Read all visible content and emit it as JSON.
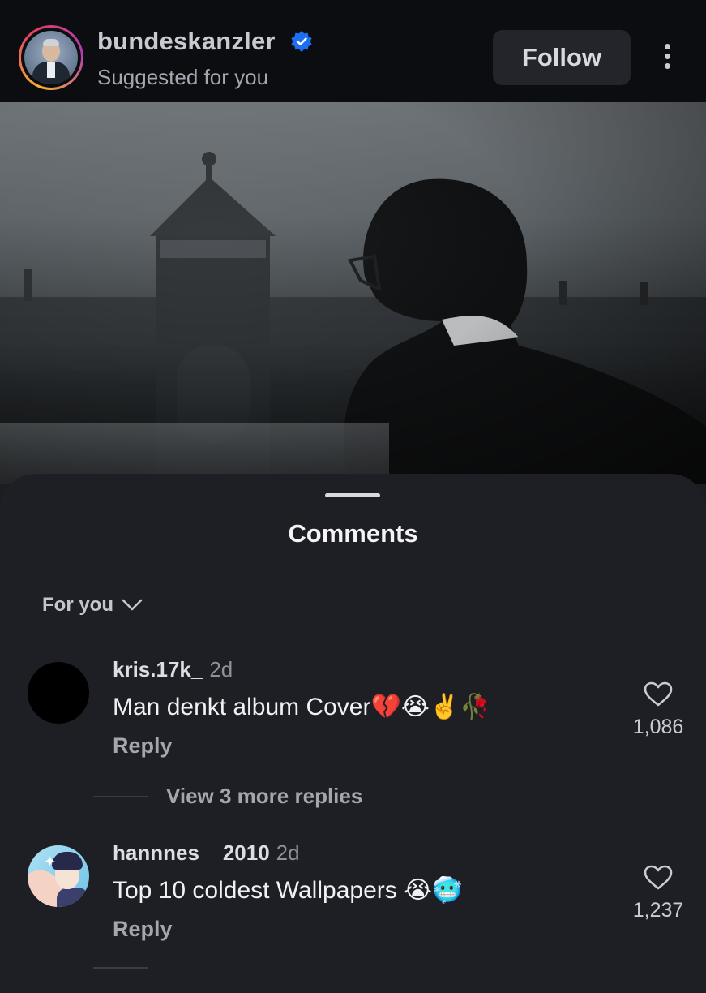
{
  "header": {
    "username": "bundeskanzler",
    "subtitle": "Suggested for you",
    "follow_label": "Follow",
    "verified_icon": "verified-badge-icon",
    "more_icon": "more-vertical-icon"
  },
  "comments_sheet": {
    "title": "Comments",
    "sort_label": "For you",
    "comments": [
      {
        "username": "kris.17k_",
        "time": "2d",
        "text": "Man denkt album Cover💔😭✌️🥀",
        "reply_label": "Reply",
        "likes": "1,086",
        "view_replies": "View 3 more replies"
      },
      {
        "username": "hannnes__2010",
        "time": "2d",
        "text": "Top 10 coldest Wallpapers 😭🥶",
        "reply_label": "Reply",
        "likes": "1,237"
      }
    ]
  },
  "colors": {
    "header_bg": "#0c0d10",
    "sheet_bg": "#1e1f24",
    "verified_blue": "#1d6ff2",
    "follow_bg": "#23252b"
  }
}
